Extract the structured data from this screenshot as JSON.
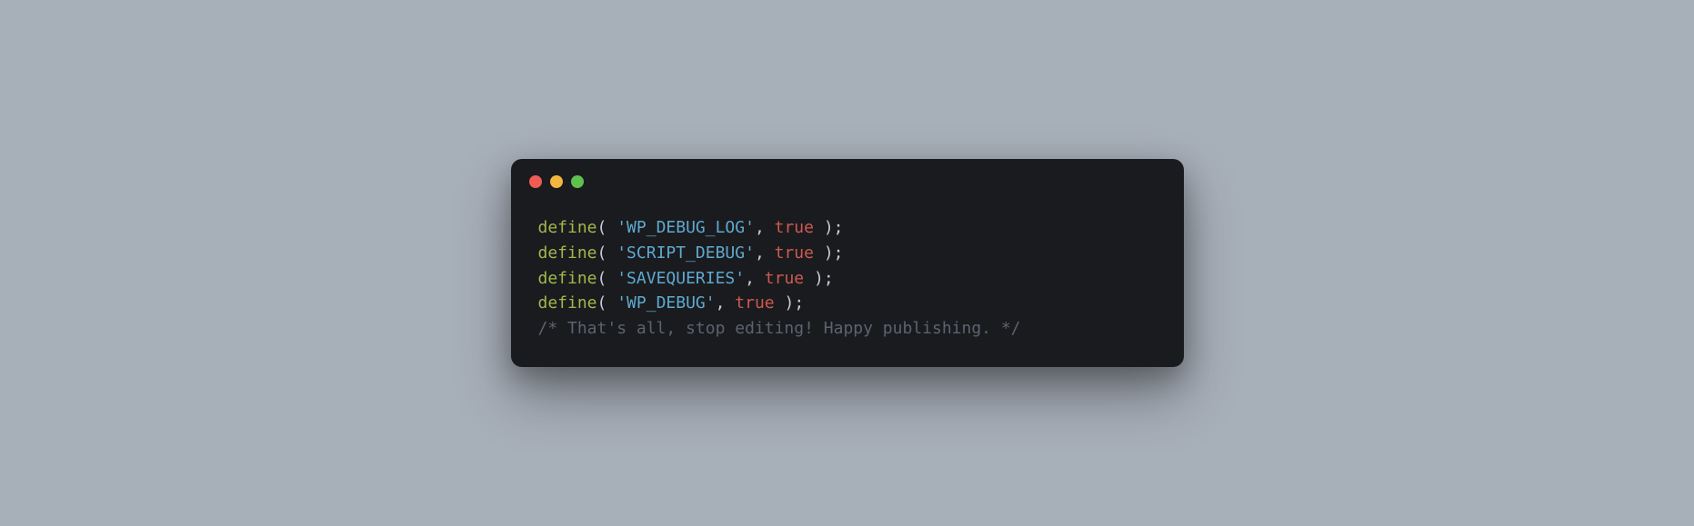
{
  "window": {
    "traffic_lights": {
      "red": "close",
      "yellow": "minimize",
      "green": "maximize"
    }
  },
  "code": {
    "lines": [
      {
        "fn": "define",
        "open": "( ",
        "str": "'WP_DEBUG_LOG'",
        "sep": ", ",
        "bool": "true",
        "close": " );"
      },
      {
        "fn": "define",
        "open": "( ",
        "str": "'SCRIPT_DEBUG'",
        "sep": ", ",
        "bool": "true",
        "close": " );"
      },
      {
        "fn": "define",
        "open": "( ",
        "str": "'SAVEQUERIES'",
        "sep": ", ",
        "bool": "true",
        "close": " );"
      },
      {
        "fn": "define",
        "open": "( ",
        "str": "'WP_DEBUG'",
        "sep": ", ",
        "bool": "true",
        "close": " );"
      }
    ],
    "comment": "/* That's all, stop editing! Happy publishing. */"
  }
}
